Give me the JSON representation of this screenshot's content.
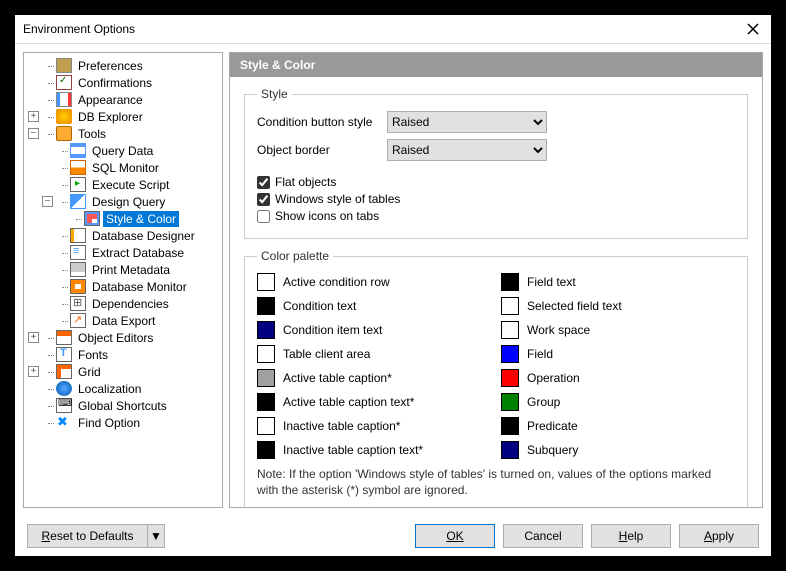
{
  "titlebar": {
    "title": "Environment Options"
  },
  "tree": {
    "preferences": "Preferences",
    "confirmations": "Confirmations",
    "appearance": "Appearance",
    "db_explorer": "DB Explorer",
    "tools": "Tools",
    "query_data": "Query Data",
    "sql_monitor": "SQL Monitor",
    "execute_script": "Execute Script",
    "design_query": "Design Query",
    "style_color": "Style & Color",
    "database_designer": "Database Designer",
    "extract_database": "Extract Database",
    "print_metadata": "Print Metadata",
    "database_monitor": "Database Monitor",
    "dependencies": "Dependencies",
    "data_export": "Data Export",
    "object_editors": "Object Editors",
    "fonts": "Fonts",
    "grid": "Grid",
    "localization": "Localization",
    "global_shortcuts": "Global Shortcuts",
    "find_option": "Find Option"
  },
  "panel": {
    "header": "Style & Color",
    "style": {
      "legend": "Style",
      "condition_button_label": "Condition button style",
      "condition_button_value": "Raised",
      "object_border_label": "Object border",
      "object_border_value": "Raised",
      "flat_objects": "Flat objects",
      "windows_style_tables": "Windows style of tables",
      "show_icons_tabs": "Show icons on tabs"
    },
    "palette": {
      "legend": "Color palette",
      "items_left": [
        {
          "label": "Active condition row",
          "color": "#ffffff"
        },
        {
          "label": "Condition text",
          "color": "#000000"
        },
        {
          "label": "Condition item text",
          "color": "#000080"
        },
        {
          "label": "Table client area",
          "color": "#ffffff"
        },
        {
          "label": "Active table caption*",
          "color": "#a0a0a0"
        },
        {
          "label": "Active table caption text*",
          "color": "#000000"
        },
        {
          "label": "Inactive table caption*",
          "color": "#ffffff"
        },
        {
          "label": "Inactive table caption text*",
          "color": "#000000"
        }
      ],
      "items_right": [
        {
          "label": "Field text",
          "color": "#000000"
        },
        {
          "label": "Selected field text",
          "color": "#ffffff"
        },
        {
          "label": "Work space",
          "color": "#ffffff"
        },
        {
          "label": "Field",
          "color": "#0000ff"
        },
        {
          "label": "Operation",
          "color": "#ff0000"
        },
        {
          "label": "Group",
          "color": "#008000"
        },
        {
          "label": "Predicate",
          "color": "#000000"
        },
        {
          "label": "Subquery",
          "color": "#000080"
        }
      ],
      "note": "Note: If the option 'Windows style of tables' is turned on, values of the options marked with the asterisk (*) symbol are ignored."
    }
  },
  "buttons": {
    "reset": "Reset to Defaults",
    "ok": "OK",
    "cancel": "Cancel",
    "help": "Help",
    "apply": "Apply"
  }
}
